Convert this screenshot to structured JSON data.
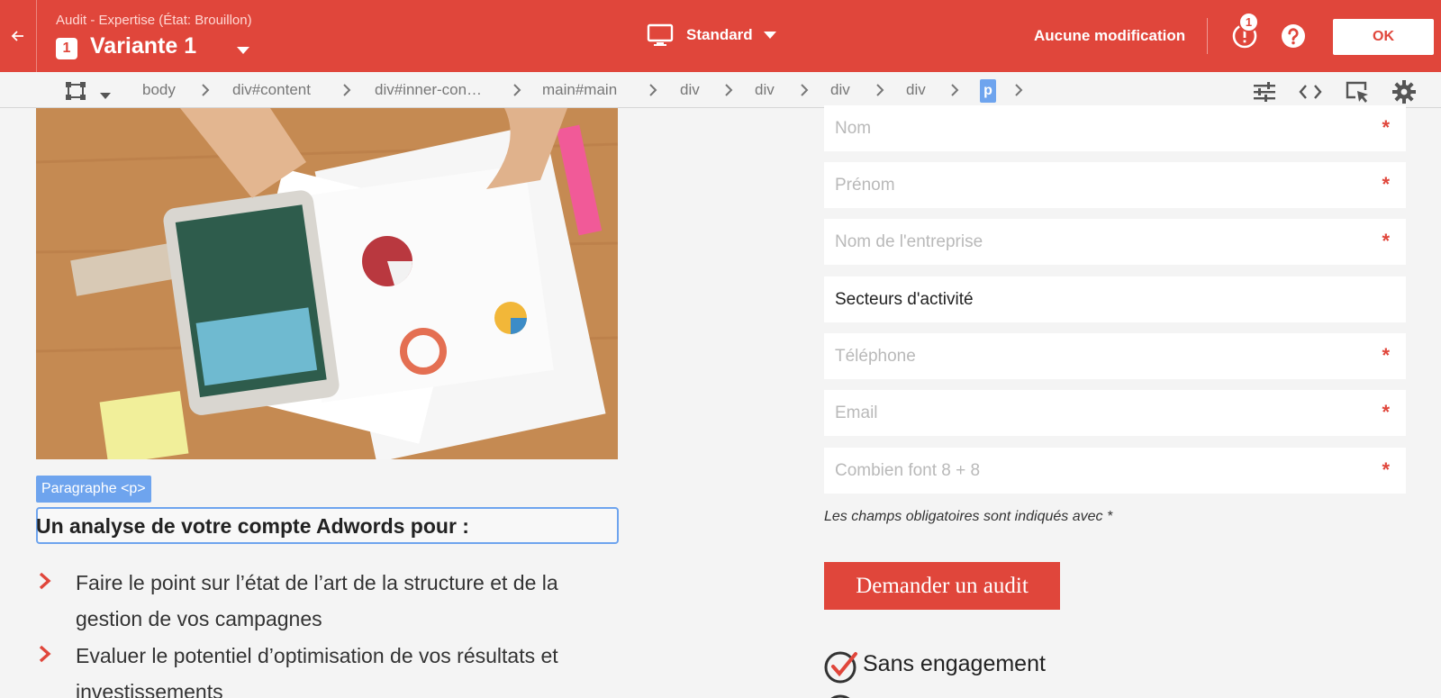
{
  "header": {
    "subtitle": "Audit - Expertise (État: Brouillon)",
    "variant_number": "1",
    "variant_name": "Variante 1",
    "device_label": "Standard",
    "save_status": "Aucune modification",
    "alert_count": "1",
    "ok_label": "OK",
    "accent_color": "#e0463b"
  },
  "breadcrumb": {
    "items": [
      "body",
      "div#content",
      "div#inner-con…",
      "main#main",
      "div",
      "div",
      "div",
      "div"
    ],
    "active": "p",
    "active_color": "#6ea4ee"
  },
  "toolbar": {
    "icons": [
      "sliders-icon",
      "code-icon",
      "select-element-icon",
      "gear-icon"
    ]
  },
  "content": {
    "element_tag": "Paragraphe <p>",
    "heading": "Un analyse de votre compte Adwords pour :",
    "list": [
      {
        "line1": "Faire le point sur l’état de l’art de la structure et de la",
        "line2": "gestion de vos campagnes"
      },
      {
        "line1": "Evaluer le potentiel d’optimisation de vos résultats et",
        "line2": "investissements"
      }
    ]
  },
  "form": {
    "fields": [
      {
        "placeholder": "Nom",
        "required": true
      },
      {
        "placeholder": "Prénom",
        "required": true
      },
      {
        "placeholder": "Nom de l'entreprise",
        "required": true
      },
      {
        "value": "Secteurs d'activité",
        "required": false
      },
      {
        "placeholder": "Téléphone",
        "required": true
      },
      {
        "placeholder": "Email",
        "required": true
      },
      {
        "placeholder": "Combien font 8 + 8",
        "required": true
      }
    ],
    "required_mark": "*",
    "required_note": "Les champs obligatoires sont indiqués avec *",
    "submit_label": "Demander un audit",
    "benefits": [
      "Sans engagement"
    ]
  }
}
